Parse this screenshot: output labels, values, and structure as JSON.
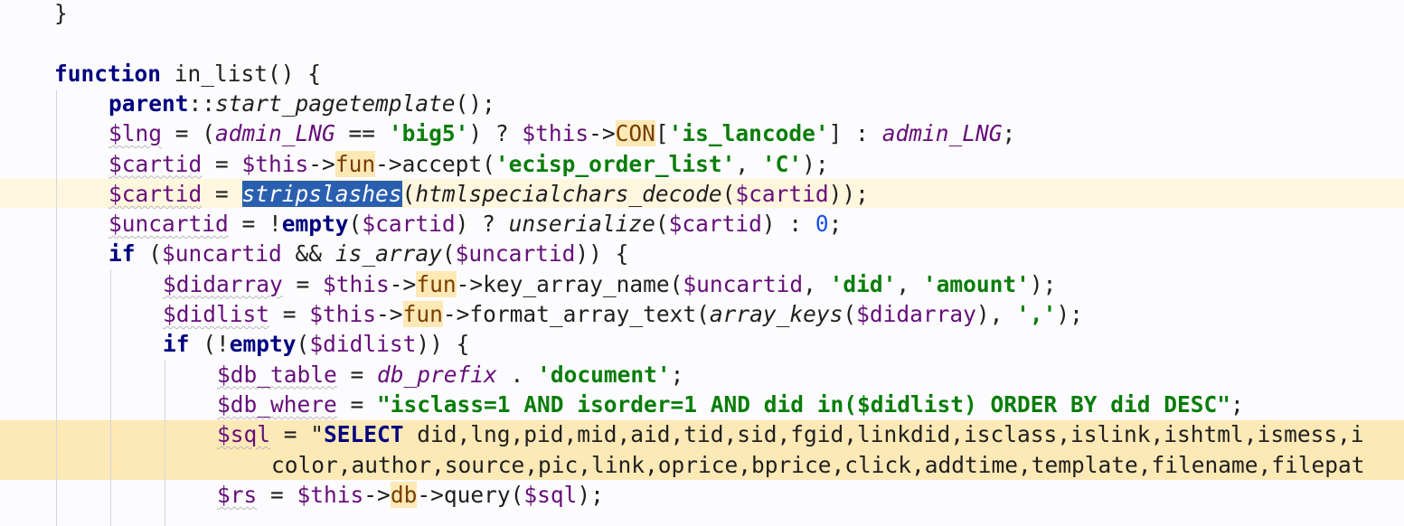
{
  "colors": {
    "background": "#fcfcfe",
    "current_line": "#fff6de",
    "sql_line": "#fde9b6",
    "selection": "#2a5fb0",
    "indent_guide": "#d4d6dc"
  },
  "lines": [
    {
      "name": "line-closing-brace",
      "indent": 1,
      "tokens": [
        {
          "t": "}",
          "c": "p"
        }
      ]
    },
    {
      "name": "line-blank",
      "indent": 1,
      "tokens": []
    },
    {
      "name": "line-function-decl",
      "indent": 1,
      "tokens": [
        {
          "t": "function",
          "c": "kw"
        },
        {
          "t": " in_list() {",
          "c": "p"
        }
      ]
    },
    {
      "name": "line-parent-call",
      "indent": 2,
      "tokens": [
        {
          "t": "parent",
          "c": "kw"
        },
        {
          "t": "::",
          "c": "p"
        },
        {
          "t": "start_pagetemplate",
          "c": "fnit"
        },
        {
          "t": "();",
          "c": "p"
        }
      ]
    },
    {
      "name": "line-lng",
      "indent": 2,
      "tokens": [
        {
          "t": "$lng",
          "c": "var"
        },
        {
          "t": " = (",
          "c": "p"
        },
        {
          "t": "admin_LNG",
          "c": "con"
        },
        {
          "t": " == ",
          "c": "p"
        },
        {
          "t": "'big5'",
          "c": "str"
        },
        {
          "t": ") ? ",
          "c": "p"
        },
        {
          "t": "$this",
          "c": "var"
        },
        {
          "t": "->",
          "c": "p"
        },
        {
          "t": "CON",
          "c": "fld"
        },
        {
          "t": "[",
          "c": "p"
        },
        {
          "t": "'is_lancode'",
          "c": "str"
        },
        {
          "t": "] : ",
          "c": "p"
        },
        {
          "t": "admin_LNG",
          "c": "con"
        },
        {
          "t": ";",
          "c": "p"
        }
      ]
    },
    {
      "name": "line-cartid-accept",
      "indent": 2,
      "tokens": [
        {
          "t": "$cartid",
          "c": "var"
        },
        {
          "t": " = ",
          "c": "p"
        },
        {
          "t": "$this",
          "c": "var"
        },
        {
          "t": "->",
          "c": "p"
        },
        {
          "t": "fun",
          "c": "fld"
        },
        {
          "t": "->accept(",
          "c": "p"
        },
        {
          "t": "'ecisp_order_list'",
          "c": "str"
        },
        {
          "t": ", ",
          "c": "p"
        },
        {
          "t": "'C'",
          "c": "str"
        },
        {
          "t": ");",
          "c": "p"
        }
      ]
    },
    {
      "name": "line-cartid-stripslashes",
      "indent": 2,
      "tokens": [
        {
          "t": "$cartid",
          "c": "var"
        },
        {
          "t": " = ",
          "c": "p"
        },
        {
          "t": "stripslashes",
          "c": "sel"
        },
        {
          "t": "(",
          "c": "p"
        },
        {
          "t": "htmlspecialchars_decode",
          "c": "fnit"
        },
        {
          "t": "(",
          "c": "p"
        },
        {
          "t": "$cartid",
          "c": "var"
        },
        {
          "t": "));",
          "c": "p"
        }
      ]
    },
    {
      "name": "line-uncartid",
      "indent": 2,
      "tokens": [
        {
          "t": "$uncartid",
          "c": "var"
        },
        {
          "t": " = !",
          "c": "p"
        },
        {
          "t": "empty",
          "c": "kw"
        },
        {
          "t": "(",
          "c": "p"
        },
        {
          "t": "$cartid",
          "c": "var"
        },
        {
          "t": ") ? ",
          "c": "p"
        },
        {
          "t": "unserialize",
          "c": "fnit"
        },
        {
          "t": "(",
          "c": "p"
        },
        {
          "t": "$cartid",
          "c": "var"
        },
        {
          "t": ") : ",
          "c": "p"
        },
        {
          "t": "0",
          "c": "num"
        },
        {
          "t": ";",
          "c": "p"
        }
      ]
    },
    {
      "name": "line-if-uncartid",
      "indent": 2,
      "tokens": [
        {
          "t": "if",
          "c": "kw"
        },
        {
          "t": " (",
          "c": "p"
        },
        {
          "t": "$uncartid",
          "c": "var"
        },
        {
          "t": " && ",
          "c": "p"
        },
        {
          "t": "is_array",
          "c": "fnit"
        },
        {
          "t": "(",
          "c": "p"
        },
        {
          "t": "$uncartid",
          "c": "var"
        },
        {
          "t": ")) {",
          "c": "p"
        }
      ]
    },
    {
      "name": "line-didarray",
      "indent": 3,
      "tokens": [
        {
          "t": "$didarray",
          "c": "var"
        },
        {
          "t": " = ",
          "c": "p"
        },
        {
          "t": "$this",
          "c": "var"
        },
        {
          "t": "->",
          "c": "p"
        },
        {
          "t": "fun",
          "c": "fld"
        },
        {
          "t": "->key_array_name(",
          "c": "p"
        },
        {
          "t": "$uncartid",
          "c": "var"
        },
        {
          "t": ", ",
          "c": "p"
        },
        {
          "t": "'did'",
          "c": "str"
        },
        {
          "t": ", ",
          "c": "p"
        },
        {
          "t": "'amount'",
          "c": "str"
        },
        {
          "t": ");",
          "c": "p"
        }
      ]
    },
    {
      "name": "line-didlist",
      "indent": 3,
      "tokens": [
        {
          "t": "$didlist",
          "c": "var"
        },
        {
          "t": " = ",
          "c": "p"
        },
        {
          "t": "$this",
          "c": "var"
        },
        {
          "t": "->",
          "c": "p"
        },
        {
          "t": "fun",
          "c": "fld"
        },
        {
          "t": "->format_array_text(",
          "c": "p"
        },
        {
          "t": "array_keys",
          "c": "fnit"
        },
        {
          "t": "(",
          "c": "p"
        },
        {
          "t": "$didarray",
          "c": "var"
        },
        {
          "t": "), ",
          "c": "p"
        },
        {
          "t": "','",
          "c": "str"
        },
        {
          "t": ");",
          "c": "p"
        }
      ]
    },
    {
      "name": "line-if-didlist",
      "indent": 3,
      "tokens": [
        {
          "t": "if",
          "c": "kw"
        },
        {
          "t": " (!",
          "c": "p"
        },
        {
          "t": "empty",
          "c": "kw"
        },
        {
          "t": "(",
          "c": "p"
        },
        {
          "t": "$didlist",
          "c": "var"
        },
        {
          "t": ")) {",
          "c": "p"
        }
      ]
    },
    {
      "name": "line-db-table",
      "indent": 4,
      "tokens": [
        {
          "t": "$db_table",
          "c": "var"
        },
        {
          "t": " = ",
          "c": "p"
        },
        {
          "t": "db_prefix",
          "c": "con"
        },
        {
          "t": " . ",
          "c": "p"
        },
        {
          "t": "'document'",
          "c": "str"
        },
        {
          "t": ";",
          "c": "p"
        }
      ]
    },
    {
      "name": "line-db-where",
      "indent": 4,
      "tokens": [
        {
          "t": "$db_where",
          "c": "var"
        },
        {
          "t": " = ",
          "c": "p"
        },
        {
          "t": "\"isclass=1 AND isorder=1 AND did in($didlist) ORDER BY did DESC\"",
          "c": "str"
        },
        {
          "t": ";",
          "c": "p"
        }
      ]
    },
    {
      "name": "line-sql",
      "indent": 4,
      "tokens": [
        {
          "t": "$sql",
          "c": "var"
        },
        {
          "t": " = \"",
          "c": "p"
        },
        {
          "t": "SELECT",
          "c": "sqlkw"
        },
        {
          "t": " did,lng,pid,mid,aid,tid,sid,fgid,linkdid,isclass,islink,ishtml,ismess,i",
          "c": "p"
        }
      ]
    },
    {
      "name": "line-sql-continued",
      "indent": 5,
      "tokens": [
        {
          "t": "color,author,source,pic,link,oprice,bprice,click,addtime,template,filename,filepat",
          "c": "p"
        }
      ]
    },
    {
      "name": "line-rs-query",
      "indent": 4,
      "tokens": [
        {
          "t": "$rs",
          "c": "var"
        },
        {
          "t": " = ",
          "c": "p"
        },
        {
          "t": "$this",
          "c": "var"
        },
        {
          "t": "->",
          "c": "p"
        },
        {
          "t": "db",
          "c": "fld"
        },
        {
          "t": "->query(",
          "c": "p"
        },
        {
          "t": "$sql",
          "c": "var"
        },
        {
          "t": ");",
          "c": "p"
        }
      ]
    }
  ]
}
